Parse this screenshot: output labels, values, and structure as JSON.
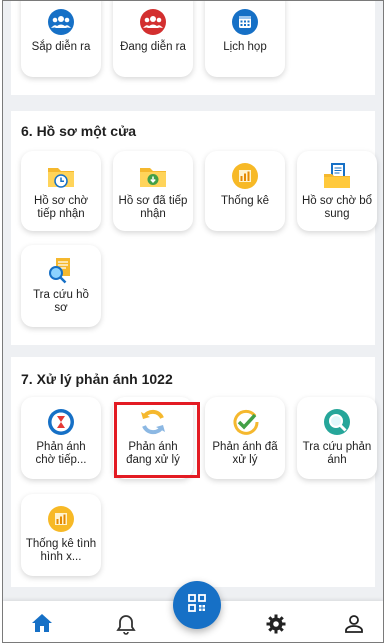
{
  "meetings": {
    "tiles": [
      {
        "label": "Sắp diễn ra",
        "icon": "people-group-icon"
      },
      {
        "label": "Đang diễn ra",
        "icon": "people-group-icon"
      },
      {
        "label": "Lịch họp",
        "icon": "calendar-icon"
      }
    ]
  },
  "one_stop": {
    "title": "6. Hồ sơ một cửa",
    "tiles": [
      {
        "label": "Hồ sơ chờ tiếp nhận",
        "icon": "folder-clock-icon"
      },
      {
        "label": "Hồ sơ đã tiếp nhận",
        "icon": "folder-download-icon"
      },
      {
        "label": "Thống kê",
        "icon": "chart-icon"
      },
      {
        "label": "Hồ sơ chờ bổ sung",
        "icon": "folder-documents-icon"
      },
      {
        "label": "Tra cứu hồ sơ",
        "icon": "document-search-icon"
      }
    ]
  },
  "feedback": {
    "title": "7. Xử lý phản ánh 1022",
    "tiles": [
      {
        "label": "Phản ánh chờ tiếp...",
        "icon": "hourglass-icon"
      },
      {
        "label": "Phản ánh đang xử lý",
        "icon": "refresh-icon"
      },
      {
        "label": "Phản ánh đã xử lý",
        "icon": "checkmark-icon"
      },
      {
        "label": "Tra cứu phản ánh",
        "icon": "search-icon"
      },
      {
        "label": "Thống kê tình hình x...",
        "icon": "chart-icon"
      }
    ]
  },
  "bottom_nav": {
    "items": [
      "home-icon",
      "bell-icon",
      "qr-code-icon",
      "gear-icon",
      "user-icon"
    ]
  },
  "colors": {
    "accent": "#1670c6",
    "highlight": "#e31b23"
  }
}
